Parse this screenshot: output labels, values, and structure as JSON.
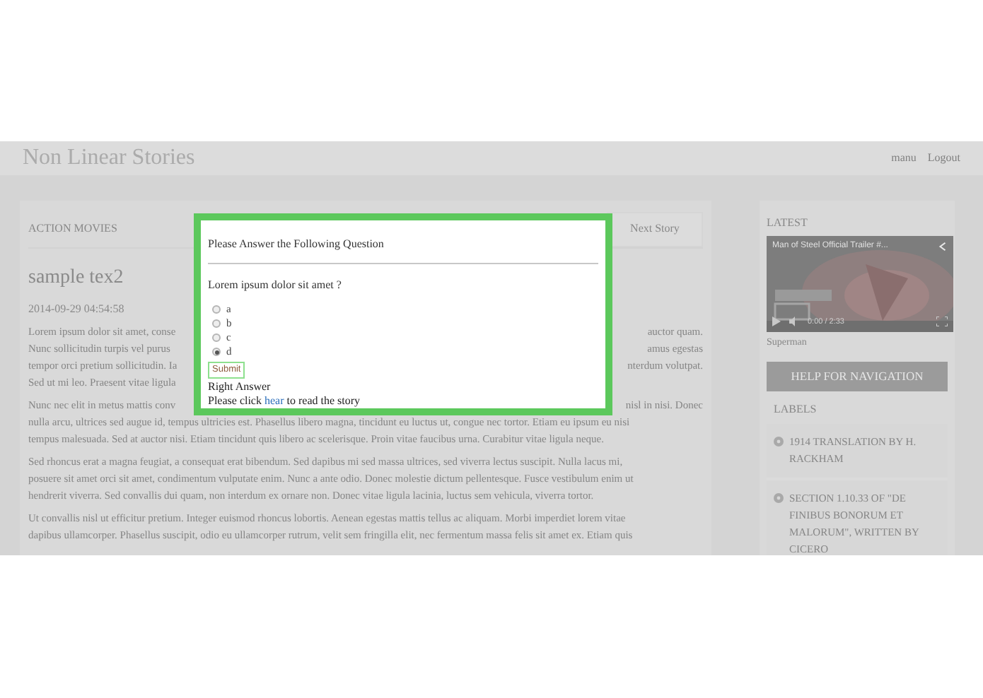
{
  "header": {
    "title": "Non Linear Stories",
    "user": "manu",
    "logout": "Logout"
  },
  "main": {
    "section_title": "ACTION MOVIES",
    "next_button": "Next Story",
    "post_title": "sample tex2",
    "post_date": "2014-09-29 04:54:58",
    "paragraphs": [
      {
        "lines": [
          {
            "left": "Lorem ipsum dolor sit amet, conse",
            "right": "auctor quam."
          },
          {
            "left": "Nunc sollicitudin turpis vel purus",
            "right": "amus egestas"
          },
          {
            "left": "tempor orci pretium sollicitudin. Ia",
            "right": "nterdum volutpat."
          },
          {
            "left": "Sed ut mi leo. Praesent vitae ligula"
          }
        ]
      },
      {
        "lines": [
          {
            "left": "Nunc nec elit in metus mattis conv",
            "right": "nisl in nisi. Donec"
          },
          {
            "left": "nulla arcu, ultrices sed augue id, tempus ultricies est. Phasellus libero magna, tincidunt eu luctus ut, congue nec tortor. Etiam eu ipsum eu nisi"
          },
          {
            "left": "tempus malesuada. Sed at auctor nisi. Etiam tincidunt quis libero ac scelerisque. Proin vitae faucibus urna. Curabitur vitae ligula neque."
          }
        ]
      },
      {
        "lines": [
          {
            "left": "Sed rhoncus erat a magna feugiat, a consequat erat bibendum. Sed dapibus mi sed massa ultrices, sed viverra lectus suscipit. Nulla lacus mi,"
          },
          {
            "left": "posuere sit amet orci sit amet, condimentum vulputate enim. Nunc a ante odio. Donec molestie dictum pellentesque. Fusce vestibulum enim ut"
          },
          {
            "left": "hendrerit viverra. Sed convallis dui quam, non interdum ex ornare non. Donec vitae ligula lacinia, luctus sem vehicula, viverra tortor."
          }
        ]
      },
      {
        "lines": [
          {
            "left": "Ut convallis nisl ut efficitur pretium. Integer euismod rhoncus lobortis. Aenean egestas mattis tellus ac aliquam. Morbi imperdiet lorem vitae"
          },
          {
            "left": "dapibus ullamcorper. Phasellus suscipit, odio eu ullamcorper rutrum, velit sem fringilla elit, nec fermentum massa felis sit amet ex. Etiam quis"
          }
        ]
      }
    ]
  },
  "sidebar": {
    "latest_title": "LATEST",
    "video": {
      "title": "Man of Steel Official Trailer #...",
      "time": "0:00 / 2:33"
    },
    "caption": "Superman",
    "help_button": "HELP FOR NAVIGATION",
    "labels_title": "LABELS",
    "labels": [
      "1914 TRANSLATION BY H. RACKHAM",
      "SECTION 1.10.33 OF \"DE FINIBUS BONORUM ET MALORUM\", WRITTEN BY CICERO"
    ]
  },
  "modal": {
    "title": "Please Answer the Following Question",
    "question": "Lorem ipsum dolor sit amet ?",
    "options": [
      {
        "label": "a",
        "selected": false
      },
      {
        "label": "b",
        "selected": false
      },
      {
        "label": "c",
        "selected": false
      },
      {
        "label": "d",
        "selected": true
      }
    ],
    "submit": "Submit",
    "result": "Right Answer",
    "link_sentence": {
      "before": "Please click ",
      "link": "hear",
      "after": " to read the story"
    }
  }
}
